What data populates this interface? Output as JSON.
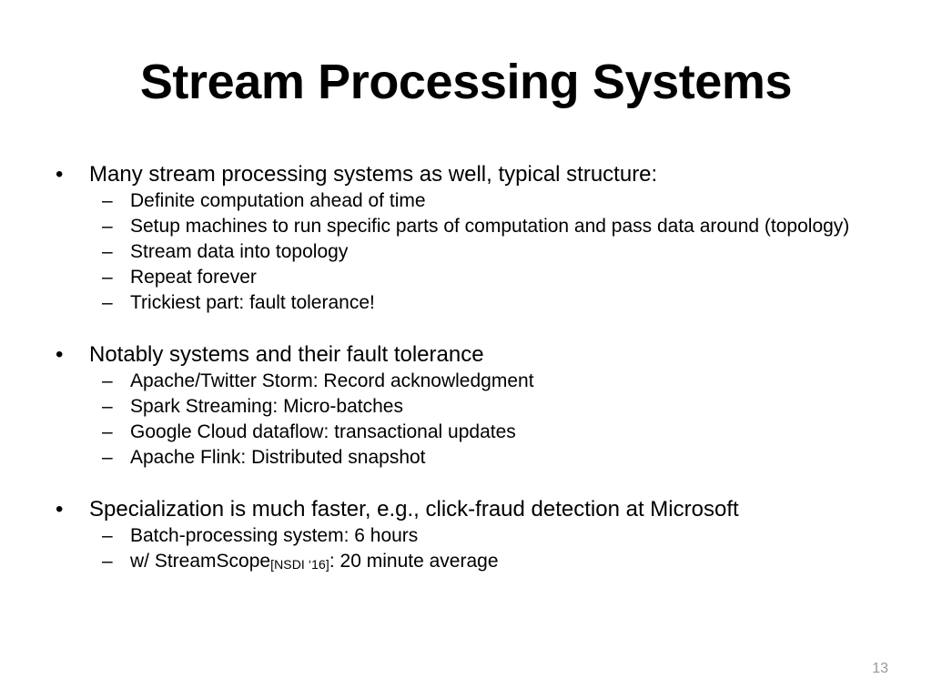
{
  "slide": {
    "title": "Stream Processing Systems",
    "page_number": "13",
    "background_color": "#ffffff",
    "text_color": "#000000",
    "page_number_color": "#9a9a9a",
    "bullet_marker": "•",
    "dash_marker": "–"
  },
  "blocks": [
    {
      "heading": "Many stream processing systems as well, typical structure:",
      "items": [
        {
          "text": "Definite computation ahead of time"
        },
        {
          "text": "Setup machines to run specific parts of computation and pass data around (topology)"
        },
        {
          "text": "Stream data into topology"
        },
        {
          "text": "Repeat forever"
        },
        {
          "text": "Trickiest part: fault tolerance!"
        }
      ]
    },
    {
      "heading": "Notably systems and their fault tolerance",
      "items": [
        {
          "text": "Apache/Twitter Storm: Record acknowledgment"
        },
        {
          "text": "Spark Streaming: Micro-batches"
        },
        {
          "text": "Google Cloud dataflow: transactional updates"
        },
        {
          "text": "Apache Flink: Distributed snapshot"
        }
      ]
    },
    {
      "heading": "Specialization is much faster, e.g., click-fraud detection at Microsoft",
      "items": [
        {
          "text": "Batch-processing system: 6 hours"
        },
        {
          "text_before": "w/ StreamScope",
          "reference": "[NSDI ‘16]",
          "text_after": ": 20 minute average"
        }
      ]
    }
  ]
}
